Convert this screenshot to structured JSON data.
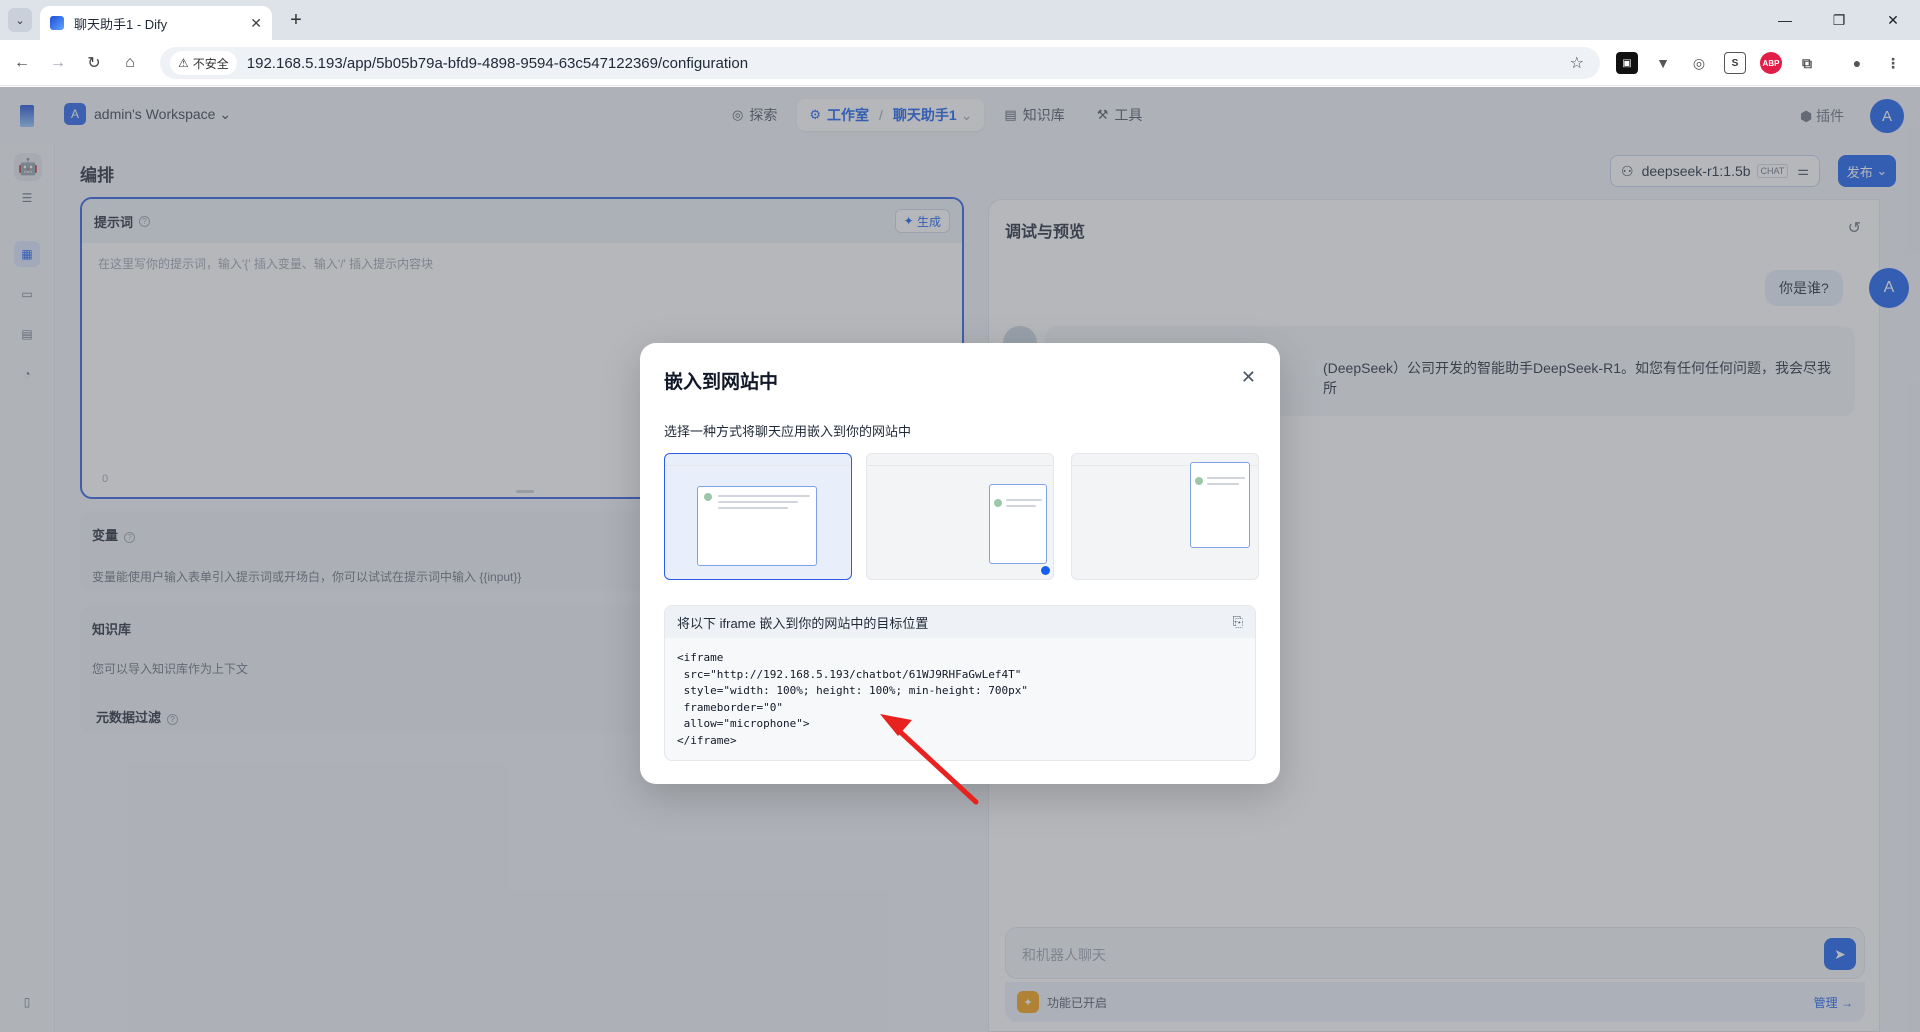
{
  "browser": {
    "tab_title": "聊天助手1 - Dify",
    "insecure_label": "不安全",
    "url": "192.168.5.193/app/5b05b79a-bfd9-4898-9594-63c547122369/configuration"
  },
  "header": {
    "workspace_initial": "A",
    "workspace_name": "admin's Workspace",
    "nav": {
      "explore": "探索",
      "studio": "工作室",
      "app_name": "聊天助手1",
      "knowledge": "知识库",
      "tools": "工具"
    },
    "plugins": "插件",
    "user_initial": "A"
  },
  "editor": {
    "title": "编排",
    "prompt": {
      "title": "提示词",
      "generate": "生成",
      "placeholder": "在这里写你的提示词，输入'{' 插入变量、输入'/' 插入提示内容块",
      "count": "0"
    },
    "variables": {
      "title": "变量",
      "desc": "变量能使用户输入表单引入提示词或开场白，你可以试试在提示词中输入 {{input}}"
    },
    "knowledge": {
      "title": "知识库",
      "desc": "您可以导入知识库作为上下文",
      "metadata_filter": "元数据过滤"
    }
  },
  "model": {
    "name": "deepseek-r1:1.5b",
    "tag": "CHAT",
    "publish": "发布"
  },
  "debug": {
    "title": "调试与预览",
    "user_message": "你是谁?",
    "bot_message_partial": "(DeepSeek）公司开发的智能助手DeepSeek-R1。如您有任何任何问题，我会尽我所",
    "input_placeholder": "和机器人聊天",
    "features_on": "功能已开启",
    "manage": "管理 →"
  },
  "modal": {
    "title": "嵌入到网站中",
    "subtitle": "选择一种方式将聊天应用嵌入到你的网站中",
    "code_header": "将以下 iframe 嵌入到你的网站中的目标位置",
    "code": "<iframe\n src=\"http://192.168.5.193/chatbot/61WJ9RHFaGwLef4T\"\n style=\"width: 100%; height: 100%; min-height: 700px\"\n frameborder=\"0\"\n allow=\"microphone\">\n</iframe>"
  },
  "colors": {
    "accent": "#155eef",
    "arrow": "#e8231f"
  }
}
